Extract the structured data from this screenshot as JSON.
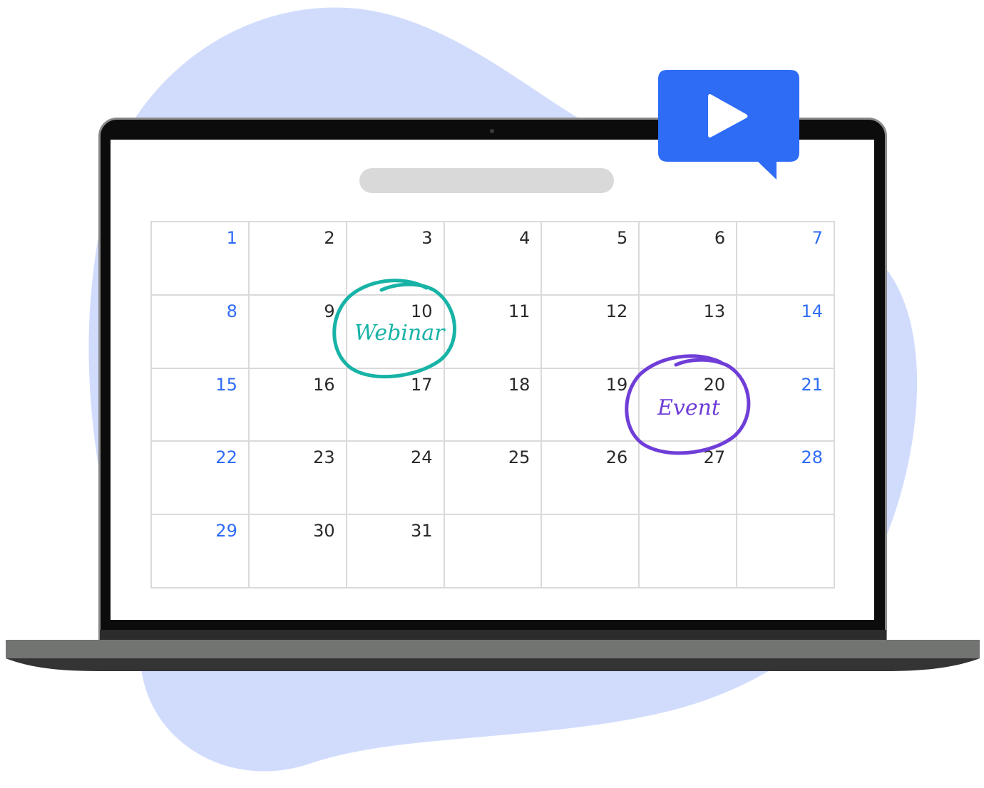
{
  "colors": {
    "blob": "#d1dcfd",
    "accent_blue": "#2e6cf6",
    "webinar_teal": "#17b3a6",
    "event_purple": "#6f3ed8",
    "grid_line": "#dadada"
  },
  "video_badge": {
    "icon": "play-icon"
  },
  "calendar": {
    "days": [
      {
        "label": "1",
        "weekend": true
      },
      {
        "label": "2"
      },
      {
        "label": "3"
      },
      {
        "label": "4"
      },
      {
        "label": "5"
      },
      {
        "label": "6"
      },
      {
        "label": "7",
        "weekend": true
      },
      {
        "label": "8",
        "weekend": true
      },
      {
        "label": "9"
      },
      {
        "label": "10"
      },
      {
        "label": "11"
      },
      {
        "label": "12"
      },
      {
        "label": "13"
      },
      {
        "label": "14",
        "weekend": true
      },
      {
        "label": "15",
        "weekend": true
      },
      {
        "label": "16"
      },
      {
        "label": "17"
      },
      {
        "label": "18"
      },
      {
        "label": "19"
      },
      {
        "label": "20"
      },
      {
        "label": "21",
        "weekend": true
      },
      {
        "label": "22",
        "weekend": true
      },
      {
        "label": "23"
      },
      {
        "label": "24"
      },
      {
        "label": "25"
      },
      {
        "label": "26"
      },
      {
        "label": "27"
      },
      {
        "label": "28",
        "weekend": true
      },
      {
        "label": "29",
        "weekend": true
      },
      {
        "label": "30"
      },
      {
        "label": "31"
      },
      {
        "label": ""
      },
      {
        "label": ""
      },
      {
        "label": ""
      },
      {
        "label": ""
      }
    ]
  },
  "annotations": {
    "webinar": "Webinar",
    "event": "Event"
  }
}
